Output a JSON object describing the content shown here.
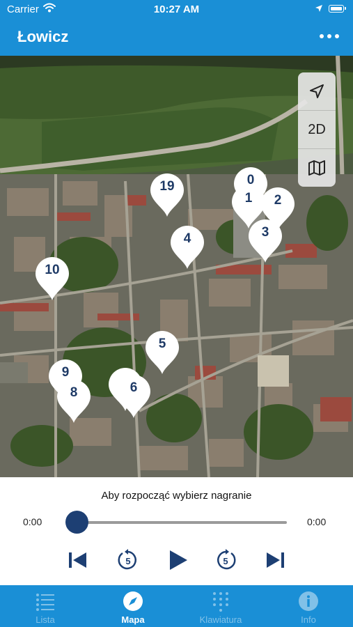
{
  "status_bar": {
    "carrier": "Carrier",
    "time": "10:27 AM"
  },
  "nav": {
    "title": "Łowicz",
    "more_icon": "more-dots-icon"
  },
  "map_controls": {
    "mode_label": "2D",
    "locate_icon": "location-arrow-icon",
    "map_icon": "map-icon"
  },
  "pins": [
    "0",
    "1",
    "2",
    "3",
    "4",
    "5",
    "6",
    "8",
    "9",
    "10",
    "19"
  ],
  "player": {
    "hint": "Aby rozpocząć wybierz nagranie",
    "elapsed": "0:00",
    "remaining": "0:00",
    "progress": 0,
    "skip_back_label": "5",
    "skip_forward_label": "5"
  },
  "tabs": [
    {
      "label": "Lista",
      "icon": "list-icon",
      "active": false
    },
    {
      "label": "Mapa",
      "icon": "compass-icon",
      "active": true
    },
    {
      "label": "Klawiatura",
      "icon": "keypad-icon",
      "active": false
    },
    {
      "label": "Info",
      "icon": "info-icon",
      "active": false
    }
  ],
  "colors": {
    "accent": "#1a8fd6",
    "pin_text": "#1e3a66",
    "player_dark": "#1d3f73"
  }
}
